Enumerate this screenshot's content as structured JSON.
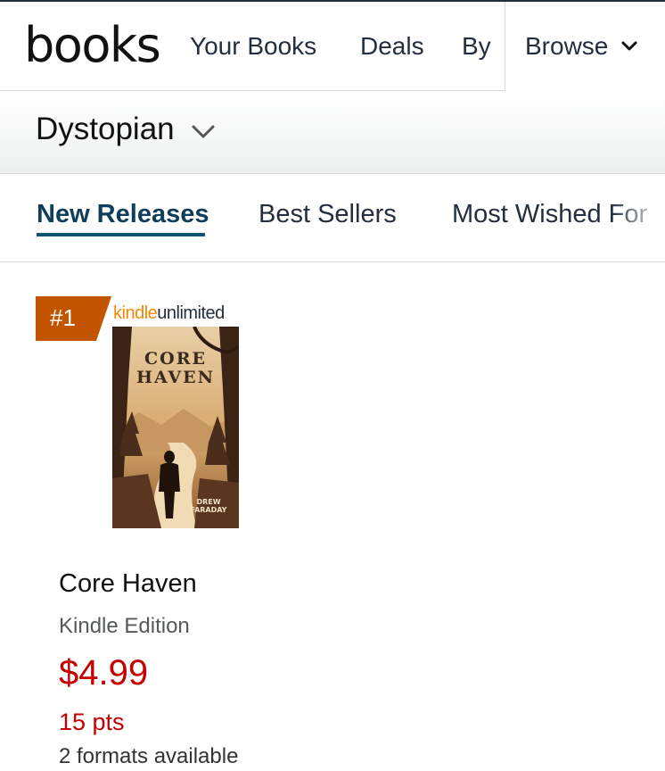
{
  "header": {
    "logo_text": "books",
    "nav": [
      "Your Books",
      "Deals"
    ],
    "nav_clipped": "By",
    "browse_label": "Browse"
  },
  "category": {
    "label": "Dystopian"
  },
  "tabs": [
    {
      "label": "New Releases",
      "active": true
    },
    {
      "label": "Best Sellers",
      "active": false
    },
    {
      "label": "Most Wished For",
      "active": false
    }
  ],
  "product": {
    "rank": "#1",
    "program_badge": {
      "kindle": "kindle",
      "unlimited": "unlimited"
    },
    "cover": {
      "title_line1": "CORE",
      "title_line2": "HAVEN",
      "author_line1": "DREW",
      "author_line2": "FARADAY"
    },
    "title": "Core Haven",
    "edition": "Kindle Edition",
    "price": "$4.99",
    "points": "15 pts",
    "formats": "2 formats available"
  },
  "colors": {
    "rank_badge": "#c45500",
    "price": "#c40000",
    "active_tab_underline": "#0f5573",
    "kindle_orange": "#f08804"
  },
  "icons": [
    "chevron-down-icon",
    "chevron-down-icon"
  ]
}
